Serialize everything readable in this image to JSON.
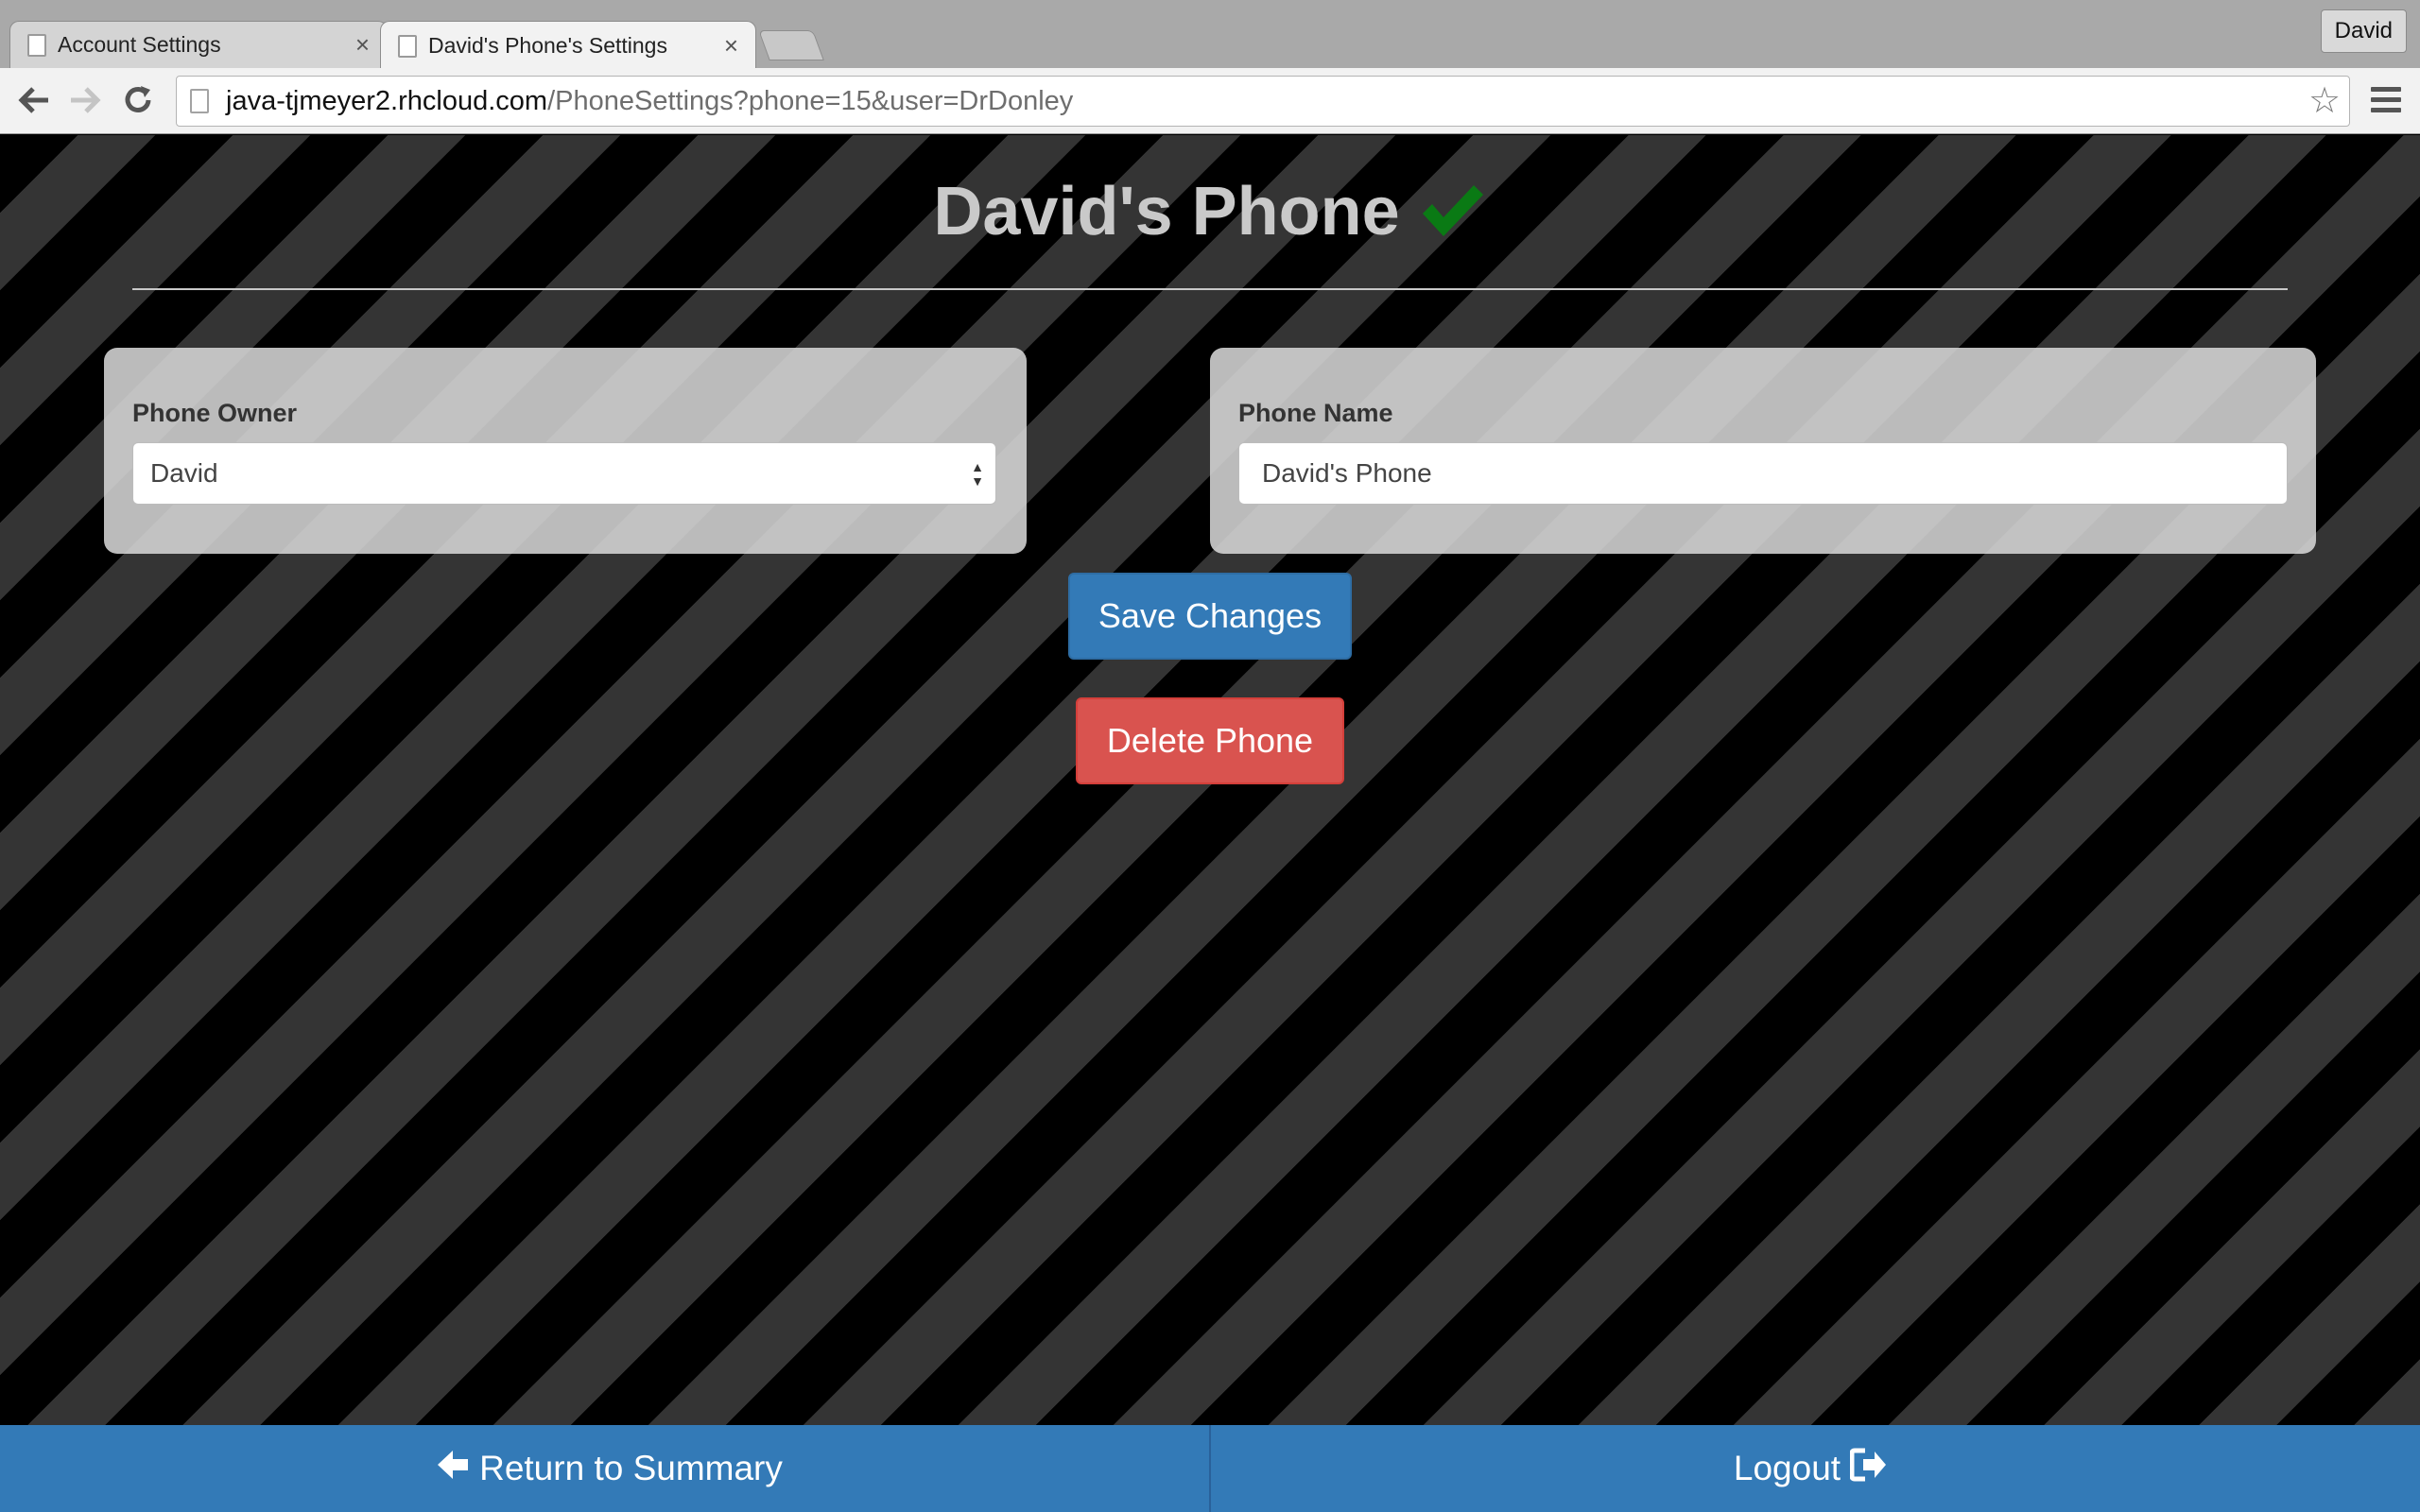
{
  "browser": {
    "tabs": [
      {
        "label": "Account Settings",
        "active": false
      },
      {
        "label": "David's Phone's Settings",
        "active": true
      }
    ],
    "profile": "David",
    "url_host": "java-tjmeyer2.rhcloud.com",
    "url_path": "/PhoneSettings?phone=15&user=DrDonley"
  },
  "page": {
    "title": "David's Phone",
    "status_icon": "checkmark-icon",
    "status_color": "#0a7a14"
  },
  "owner_panel": {
    "label": "Phone Owner",
    "selected": "David"
  },
  "name_panel": {
    "label": "Phone Name",
    "value": "David's Phone"
  },
  "buttons": {
    "save": "Save Changes",
    "delete": "Delete Phone"
  },
  "footer": {
    "return_label": "Return to Summary",
    "logout_label": "Logout"
  },
  "colors": {
    "primary": "#337ab7",
    "danger": "#d9534f"
  }
}
